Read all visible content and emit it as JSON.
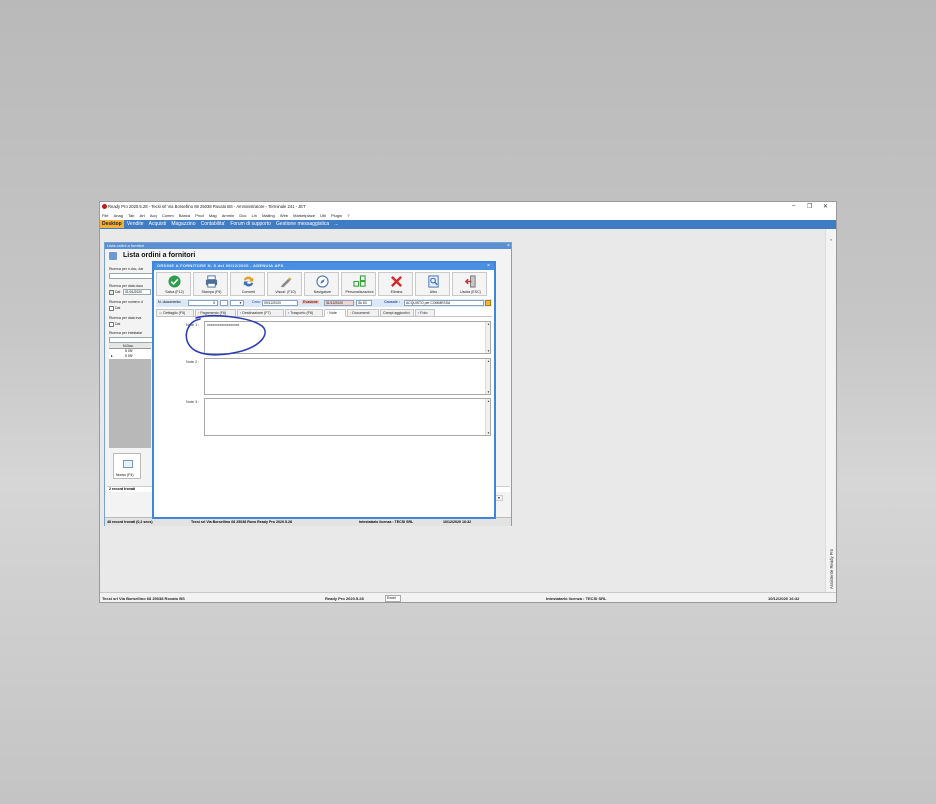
{
  "app": {
    "title": "Ready Pro 2020.5.28 - Tecsi srl Via Borsellino 68 25038 Rovato BS - Amministratore - Terminale 241 - JET",
    "window_controls": [
      "–",
      "❐",
      "✕"
    ]
  },
  "menu": [
    "File",
    "Anag",
    "Tab",
    "Art",
    "Acq",
    "Comm",
    "Banca",
    "Prod",
    "Mag",
    "Ammin",
    "Doc",
    "Lin",
    "Mailing",
    "Web",
    "Marketplace",
    "Util",
    "Plugin",
    "?"
  ],
  "modules": [
    "Desktop",
    "Vendite",
    "Acquisti",
    "Magazzino",
    "Contabilita'",
    "Forum di supporto",
    "Gestione messaggistica",
    "..."
  ],
  "list_window": {
    "caption": "Lista ordini a fornitori",
    "title": "Lista ordini a fornitori",
    "filters": [
      {
        "label": "Ricerca per n.doc, dar",
        "value": ""
      },
      {
        "label": "Ricerca per data docu",
        "value": "01/01/2020",
        "check": "Dal"
      },
      {
        "label": "Ricerca per numero d",
        "value": "",
        "check": "Dal"
      },
      {
        "label": "Ricerca per data eva",
        "value": "",
        "check": "Dal"
      },
      {
        "label": "Ricerca per intestatar",
        "value": ""
      }
    ],
    "grid_header": "N.Doc.",
    "rows": [
      "5 09/",
      "5 09/"
    ],
    "new_button": "Nuovo (F4)",
    "records_inner": "2 record trovati",
    "status_records": "48 record trovati (0,2 secs)",
    "status_company": "Tecsi srl Via Borsellino 68  25038 Rovo  Ready Pro 2020.5.28",
    "status_license": "Intestatario licenza : TECSI SRL",
    "status_date": "10/12/2020  16:32"
  },
  "order_window": {
    "caption": "ORDINE A FORNITORE N. 5 del 09/12/2020 - ADENUIA APS",
    "toolbar": [
      {
        "label": "Salva (F12)",
        "icon": "check-icon",
        "color": "#2e9e4e"
      },
      {
        "label": "Stampa (F9)",
        "icon": "printer-icon",
        "color": "#4e6f9a"
      },
      {
        "label": "Converti",
        "icon": "convert-icon",
        "color": "#e6a029"
      },
      {
        "label": "Visual. (F10)",
        "icon": "pencil-icon",
        "color": "#8a8a8a"
      },
      {
        "label": "Navigatore",
        "icon": "compass-icon",
        "color": "#4a78b8"
      },
      {
        "label": "Personalizzazioni",
        "icon": "grid-icon",
        "color": "#3aa33a"
      },
      {
        "label": "Elimina",
        "icon": "delete-icon",
        "color": "#d22b2b"
      },
      {
        "label": "Altro",
        "icon": "more-icon",
        "color": "#3b6fb6"
      },
      {
        "label": "Uscita (ESC)",
        "icon": "exit-icon",
        "color": "#c23a3a"
      }
    ],
    "doc": {
      "num_label": "N. documento:",
      "num_value": "5",
      "data_label": "Data:",
      "data_value": "09/12/2020",
      "evasione_label": "Evasione",
      "evasione_value": "31/12/2020",
      "week_value": "Sk 53",
      "causale_label": "Causale :",
      "causale_value": "ACQUISTO per COMMESSA"
    },
    "tabs": [
      "Dettaglio (F5)",
      "Pagamento (F6)",
      "Destinazione (F7)",
      "Trasporto (F8)",
      "Note",
      "Documenti",
      "Campi aggiuntivi",
      "Foto"
    ],
    "selected_tab": "Note",
    "notes": [
      {
        "label": "Note 1 :",
        "value": "xxxxxxxxxxxxxxxxxx"
      },
      {
        "label": "Note 2 :",
        "value": ""
      },
      {
        "label": "Note 3 :",
        "value": ""
      }
    ],
    "annotation_color": "#2d3eb5"
  },
  "sidepanel": {
    "label": "Assistente Ready Pro"
  },
  "statusbar": {
    "company": "Tecsi srl Via Borsellino 68  25038 Rovato BS",
    "version": "Ready Pro 2020.5.28",
    "field": "Excel",
    "license": "Intestatario licenza : TECSI SRL",
    "datetime": "10/12/2020  16:32"
  }
}
